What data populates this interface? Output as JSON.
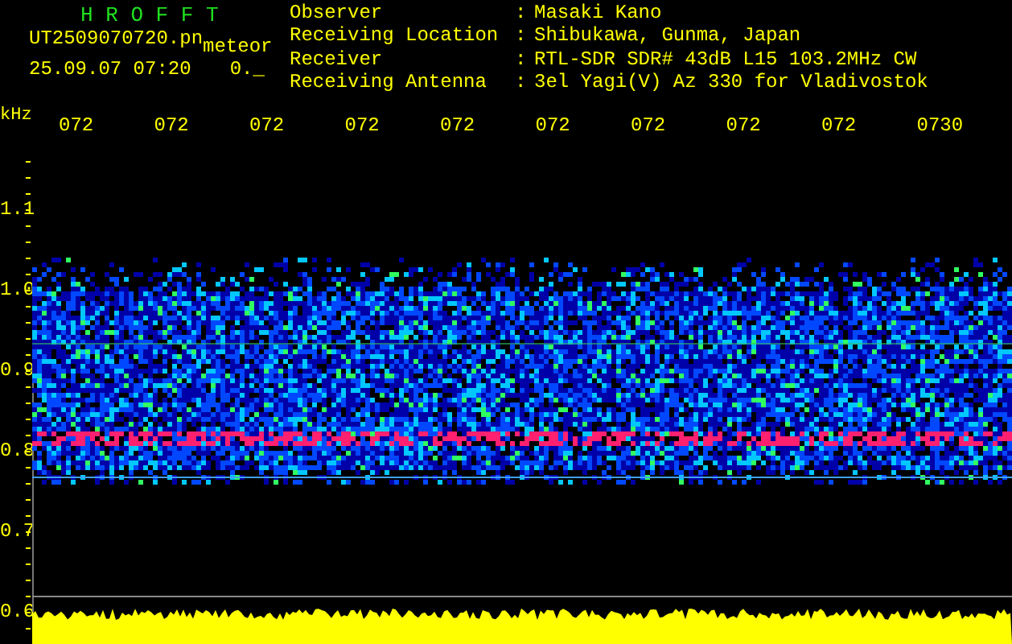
{
  "header": {
    "title": "H R O F F T",
    "filename": "UT2509070720.pn",
    "mode": "meteor",
    "datetime": "25.09.07 07:20",
    "counter": "0._"
  },
  "info": [
    {
      "label": "Observer",
      "separator": ":",
      "value": "Masaki Kano"
    },
    {
      "label": "Receiving Location",
      "separator": ":",
      "value": "Shibukawa, Gunma, Japan"
    },
    {
      "label": "Receiver",
      "separator": ":",
      "value": "RTL-SDR SDR# 43dB L15 103.2MHz CW"
    },
    {
      "label": "Receiving Antenna",
      "separator": ":",
      "value": "3el Yagi(V) Az 330 for Vladivostok"
    }
  ],
  "time_axis": [
    "072",
    "072",
    "072",
    "072",
    "072",
    "072",
    "072",
    "072",
    "072",
    "0730"
  ],
  "freq_axis": {
    "unit": "kHz",
    "labels": [
      "1.1",
      "1.0",
      "0.9",
      "0.8",
      "0.7",
      "0.6"
    ]
  }
}
